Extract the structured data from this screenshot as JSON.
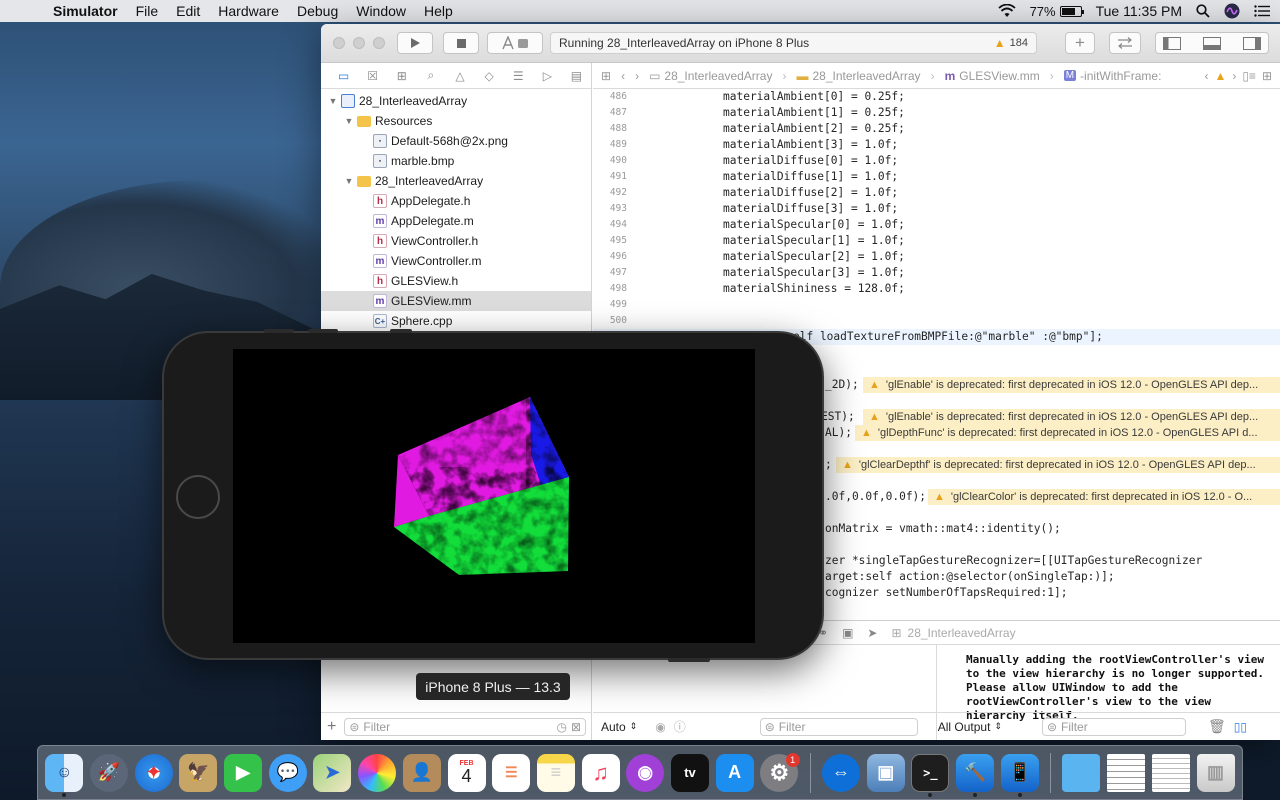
{
  "menubar": {
    "app_name": "Simulator",
    "items": [
      "File",
      "Edit",
      "Hardware",
      "Debug",
      "Window",
      "Help"
    ],
    "battery_percent": "77%",
    "battery_level": 0.77,
    "clock": "Tue 11:35 PM"
  },
  "xcode": {
    "activity_text": "Running 28_InterleavedArray on iPhone 8 Plus",
    "warning_count": "184",
    "jumpbar": [
      "28_InterleavedArray",
      "28_InterleavedArray",
      "GLESView.mm",
      "-initWithFrame:"
    ],
    "navigator": {
      "filter_placeholder": "Filter",
      "tree": [
        {
          "label": "28_InterleavedArray",
          "type": "proj",
          "depth": 0,
          "disclosure": "open"
        },
        {
          "label": "Resources",
          "type": "folder",
          "depth": 1,
          "disclosure": "open"
        },
        {
          "label": "Default-568h@2x.png",
          "type": "img",
          "depth": 2
        },
        {
          "label": "marble.bmp",
          "type": "img",
          "depth": 2
        },
        {
          "label": "28_InterleavedArray",
          "type": "folder",
          "depth": 1,
          "disclosure": "open"
        },
        {
          "label": "AppDelegate.h",
          "type": "h",
          "depth": 2
        },
        {
          "label": "AppDelegate.m",
          "type": "m",
          "depth": 2
        },
        {
          "label": "ViewController.h",
          "type": "h",
          "depth": 2
        },
        {
          "label": "ViewController.m",
          "type": "m",
          "depth": 2
        },
        {
          "label": "GLESView.h",
          "type": "h",
          "depth": 2
        },
        {
          "label": "GLESView.mm",
          "type": "m",
          "depth": 2,
          "selected": true
        },
        {
          "label": "Sphere.cpp",
          "type": "cpp",
          "depth": 2
        }
      ]
    },
    "code_lines": [
      {
        "n": "486",
        "code": "materialAmbient[0] = 0.25f;"
      },
      {
        "n": "487",
        "code": "materialAmbient[1] = 0.25f;"
      },
      {
        "n": "488",
        "code": "materialAmbient[2] = 0.25f;"
      },
      {
        "n": "489",
        "code": "materialAmbient[3] = 1.0f;"
      },
      {
        "n": "490",
        "code": "materialDiffuse[0] = 1.0f;"
      },
      {
        "n": "491",
        "code": "materialDiffuse[1] = 1.0f;"
      },
      {
        "n": "492",
        "code": "materialDiffuse[2] = 1.0f;"
      },
      {
        "n": "493",
        "code": "materialDiffuse[3] = 1.0f;"
      },
      {
        "n": "494",
        "code": "materialSpecular[0] = 1.0f;"
      },
      {
        "n": "495",
        "code": "materialSpecular[1] = 1.0f;"
      },
      {
        "n": "496",
        "code": "materialSpecular[2] = 1.0f;"
      },
      {
        "n": "497",
        "code": "materialSpecular[3] = 1.0f;"
      },
      {
        "n": "498",
        "code": "materialShininess = 128.0f;"
      },
      {
        "n": "499",
        "code": ""
      },
      {
        "n": "500",
        "code": ""
      }
    ],
    "code_fragments": [
      "elf loadTextureFromBMPFile:@\"marble\" :@\"bmp\"];",
      "_2D);",
      "EST);",
      "AL);",
      ";",
      ".0f,0.0f,0.0f);",
      "onMatrix = vmath::mat4::identity();",
      "zer *singleTapGestureRecognizer=[[UITapGestureRecognizer",
      "arget:self action:@selector(onSingleTap:)];",
      "cognizer setNumberOfTapsRequired:1];"
    ],
    "issues": [
      "'glEnable' is deprecated: first deprecated in iOS 12.0 - OpenGLES API dep...",
      "'glEnable' is deprecated: first deprecated in iOS 12.0 - OpenGLES API dep...",
      "'glDepthFunc' is deprecated: first deprecated in iOS 12.0 - OpenGLES API d...",
      "'glClearDepthf' is deprecated: first deprecated in iOS 12.0 - OpenGLES API dep...",
      "'glClearColor' is deprecated: first deprecated in iOS 12.0 - O..."
    ],
    "debug": {
      "target": "28_InterleavedArray",
      "console_text": "Manually adding the rootViewController's view\nto the view hierarchy is no longer supported.\nPlease allow UIWindow to add the\nrootViewController's view to the view\nhierarchy itself.",
      "auto_label": "Auto",
      "filter_placeholder": "Filter",
      "output_label": "All Output",
      "console_filter_placeholder": "Filter"
    }
  },
  "simulator": {
    "device_label": "iPhone 8 Plus — 13.3"
  },
  "dock": {
    "calendar_month": "FEB",
    "calendar_day": "4",
    "appletv_label": "tv",
    "badge_count": "1"
  }
}
